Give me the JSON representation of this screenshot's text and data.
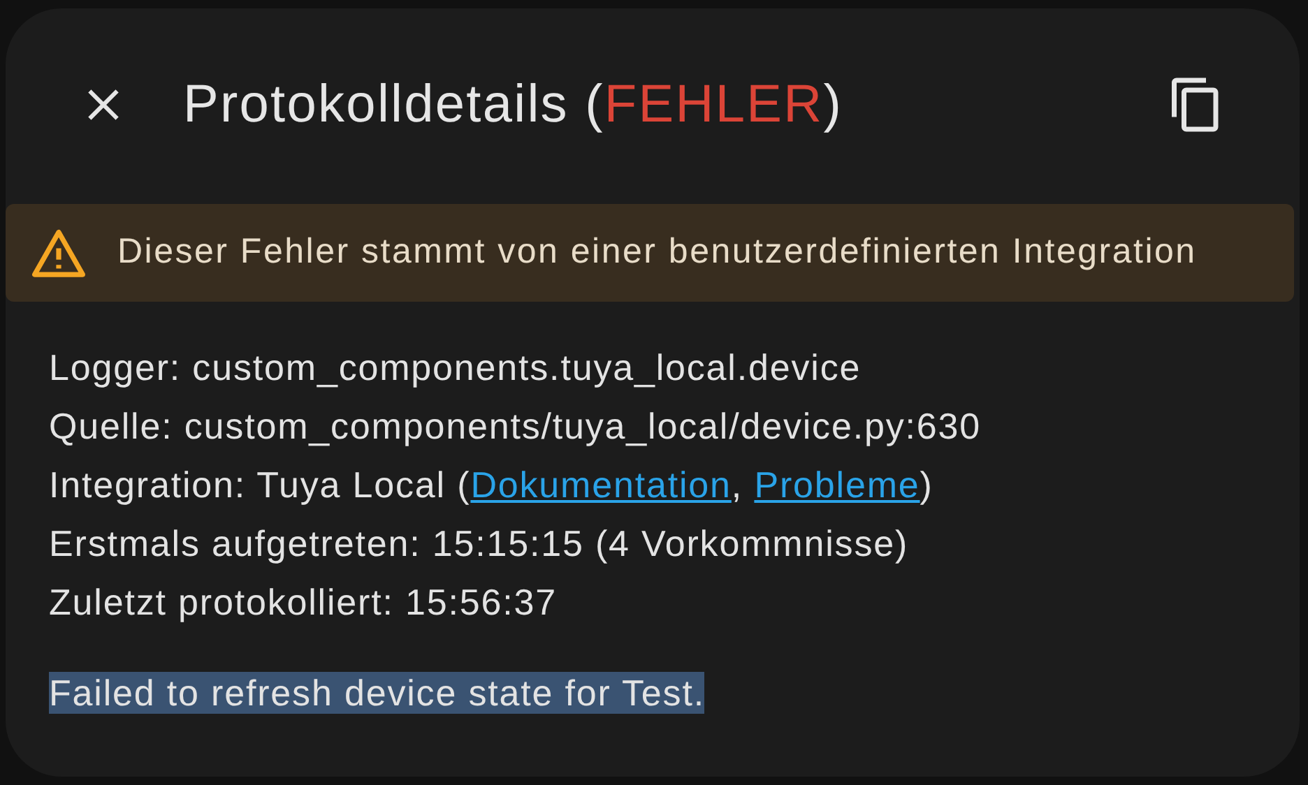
{
  "dialog": {
    "title_parts": [
      {
        "kind": "text",
        "text": "Protokolldetails ("
      },
      {
        "kind": "level",
        "text": "FEHLER"
      },
      {
        "kind": "text",
        "text": ")"
      }
    ]
  },
  "warning": {
    "text": "Dieser Fehler stammt von einer benutzerdefinierten Integration"
  },
  "details": [
    {
      "parts": [
        {
          "kind": "text",
          "text": "Logger: custom_components.tuya_local.device"
        }
      ]
    },
    {
      "parts": [
        {
          "kind": "text",
          "text": "Quelle: custom_components/tuya_local/device.py:630"
        }
      ]
    },
    {
      "parts": [
        {
          "kind": "text",
          "text": "Integration: Tuya Local ("
        },
        {
          "kind": "link",
          "text": "Dokumentation"
        },
        {
          "kind": "text",
          "text": ", "
        },
        {
          "kind": "link",
          "text": "Probleme"
        },
        {
          "kind": "text",
          "text": ")"
        }
      ]
    },
    {
      "parts": [
        {
          "kind": "text",
          "text": "Erstmals aufgetreten: 15:15:15 (4 Vorkommnisse)"
        }
      ]
    },
    {
      "parts": [
        {
          "kind": "text",
          "text": "Zuletzt protokolliert: 15:56:37"
        }
      ]
    }
  ],
  "message": {
    "text": "Failed to refresh device state for Test.",
    "selected": true
  }
}
